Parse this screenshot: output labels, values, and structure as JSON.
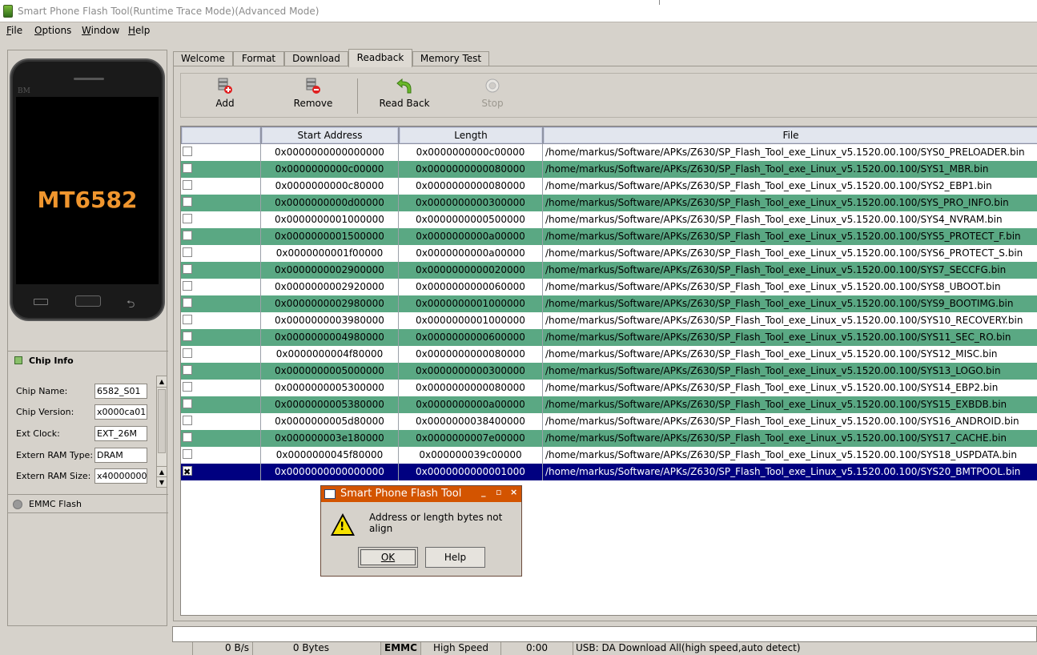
{
  "window": {
    "title": "Smart Phone Flash Tool(Runtime Trace Mode)(Advanced Mode)"
  },
  "menu": [
    {
      "label": "File",
      "ul": "F",
      "rest": "ile"
    },
    {
      "label": "Options",
      "ul": "O",
      "rest": "ptions"
    },
    {
      "label": "Window",
      "ul": "W",
      "rest": "indow"
    },
    {
      "label": "Help",
      "ul": "H",
      "rest": "elp"
    }
  ],
  "phone": {
    "brand": "BM",
    "chip": "MT6582"
  },
  "chip_info": {
    "tab_label": "Chip Info",
    "fields": [
      {
        "label": "Chip Name:",
        "value": "6582_S01"
      },
      {
        "label": "Chip Version:",
        "value": "x0000ca01"
      },
      {
        "label": "Ext Clock:",
        "value": "EXT_26M"
      },
      {
        "label": "Extern RAM Type:",
        "value": "DRAM"
      },
      {
        "label": "Extern RAM Size:",
        "value": "x40000000"
      }
    ]
  },
  "emmc_tab": {
    "label": "EMMC Flash"
  },
  "tabs": [
    {
      "label": "Welcome",
      "active": false
    },
    {
      "label": "Format",
      "active": false
    },
    {
      "label": "Download",
      "active": false
    },
    {
      "label": "Readback",
      "active": true
    },
    {
      "label": "Memory Test",
      "active": false
    }
  ],
  "toolbar": {
    "add": "Add",
    "remove": "Remove",
    "read_back": "Read Back",
    "stop": "Stop"
  },
  "table": {
    "columns": [
      "",
      "Start Address",
      "Length",
      "File"
    ],
    "rows": [
      {
        "checked": false,
        "start": "0x0000000000000000",
        "length": "0x0000000000c00000",
        "file": "/home/markus/Software/APKs/Z630/SP_Flash_Tool_exe_Linux_v5.1520.00.100/SYS0_PRELOADER.bin"
      },
      {
        "checked": false,
        "start": "0x0000000000c00000",
        "length": "0x0000000000080000",
        "file": "/home/markus/Software/APKs/Z630/SP_Flash_Tool_exe_Linux_v5.1520.00.100/SYS1_MBR.bin"
      },
      {
        "checked": false,
        "start": "0x0000000000c80000",
        "length": "0x0000000000080000",
        "file": "/home/markus/Software/APKs/Z630/SP_Flash_Tool_exe_Linux_v5.1520.00.100/SYS2_EBP1.bin"
      },
      {
        "checked": false,
        "start": "0x0000000000d00000",
        "length": "0x0000000000300000",
        "file": "/home/markus/Software/APKs/Z630/SP_Flash_Tool_exe_Linux_v5.1520.00.100/SYS_PRO_INFO.bin"
      },
      {
        "checked": false,
        "start": "0x0000000001000000",
        "length": "0x0000000000500000",
        "file": "/home/markus/Software/APKs/Z630/SP_Flash_Tool_exe_Linux_v5.1520.00.100/SYS4_NVRAM.bin"
      },
      {
        "checked": false,
        "start": "0x0000000001500000",
        "length": "0x0000000000a00000",
        "file": "/home/markus/Software/APKs/Z630/SP_Flash_Tool_exe_Linux_v5.1520.00.100/SYS5_PROTECT_F.bin"
      },
      {
        "checked": false,
        "start": "0x0000000001f00000",
        "length": "0x0000000000a00000",
        "file": "/home/markus/Software/APKs/Z630/SP_Flash_Tool_exe_Linux_v5.1520.00.100/SYS6_PROTECT_S.bin"
      },
      {
        "checked": false,
        "start": "0x0000000002900000",
        "length": "0x0000000000020000",
        "file": "/home/markus/Software/APKs/Z630/SP_Flash_Tool_exe_Linux_v5.1520.00.100/SYS7_SECCFG.bin"
      },
      {
        "checked": false,
        "start": "0x0000000002920000",
        "length": "0x0000000000060000",
        "file": "/home/markus/Software/APKs/Z630/SP_Flash_Tool_exe_Linux_v5.1520.00.100/SYS8_UBOOT.bin"
      },
      {
        "checked": false,
        "start": "0x0000000002980000",
        "length": "0x0000000001000000",
        "file": "/home/markus/Software/APKs/Z630/SP_Flash_Tool_exe_Linux_v5.1520.00.100/SYS9_BOOTIMG.bin"
      },
      {
        "checked": false,
        "start": "0x0000000003980000",
        "length": "0x0000000001000000",
        "file": "/home/markus/Software/APKs/Z630/SP_Flash_Tool_exe_Linux_v5.1520.00.100/SYS10_RECOVERY.bin"
      },
      {
        "checked": false,
        "start": "0x0000000004980000",
        "length": "0x0000000000600000",
        "file": "/home/markus/Software/APKs/Z630/SP_Flash_Tool_exe_Linux_v5.1520.00.100/SYS11_SEC_RO.bin"
      },
      {
        "checked": false,
        "start": "0x0000000004f80000",
        "length": "0x0000000000080000",
        "file": "/home/markus/Software/APKs/Z630/SP_Flash_Tool_exe_Linux_v5.1520.00.100/SYS12_MISC.bin"
      },
      {
        "checked": false,
        "start": "0x0000000005000000",
        "length": "0x0000000000300000",
        "file": "/home/markus/Software/APKs/Z630/SP_Flash_Tool_exe_Linux_v5.1520.00.100/SYS13_LOGO.bin"
      },
      {
        "checked": false,
        "start": "0x0000000005300000",
        "length": "0x0000000000080000",
        "file": "/home/markus/Software/APKs/Z630/SP_Flash_Tool_exe_Linux_v5.1520.00.100/SYS14_EBP2.bin"
      },
      {
        "checked": false,
        "start": "0x0000000005380000",
        "length": "0x0000000000a00000",
        "file": "/home/markus/Software/APKs/Z630/SP_Flash_Tool_exe_Linux_v5.1520.00.100/SYS15_EXBDB.bin"
      },
      {
        "checked": false,
        "start": "0x0000000005d80000",
        "length": "0x0000000038400000",
        "file": "/home/markus/Software/APKs/Z630/SP_Flash_Tool_exe_Linux_v5.1520.00.100/SYS16_ANDROID.bin"
      },
      {
        "checked": false,
        "start": "0x000000003e180000",
        "length": "0x0000000007e00000",
        "file": "/home/markus/Software/APKs/Z630/SP_Flash_Tool_exe_Linux_v5.1520.00.100/SYS17_CACHE.bin"
      },
      {
        "checked": false,
        "start": "0x0000000045f80000",
        "length": "0x000000039c00000",
        "file": "/home/markus/Software/APKs/Z630/SP_Flash_Tool_exe_Linux_v5.1520.00.100/SYS18_USPDATA.bin"
      },
      {
        "checked": true,
        "start": "0x0000000000000000",
        "length": "0x0000000000001000",
        "file": "/home/markus/Software/APKs/Z630/SP_Flash_Tool_exe_Linux_v5.1520.00.100/SYS20_BMTPOOL.bin"
      }
    ]
  },
  "status": {
    "speed": "0 B/s",
    "bytes": "0 Bytes",
    "storage": "EMMC",
    "mode": "High Speed",
    "time": "0:00",
    "usb": "USB: DA Download All(high speed,auto detect)"
  },
  "dialog": {
    "title": "Smart Phone Flash Tool",
    "message": "Address or length bytes not align",
    "ok": "OK",
    "help": "Help",
    "minimize": "_",
    "maximize": "▫",
    "close": "×"
  },
  "colors": {
    "row_green": "#5aa883",
    "row_selected": "#000080",
    "dialog_title": "#d35400",
    "chip_text": "#f0962e"
  }
}
